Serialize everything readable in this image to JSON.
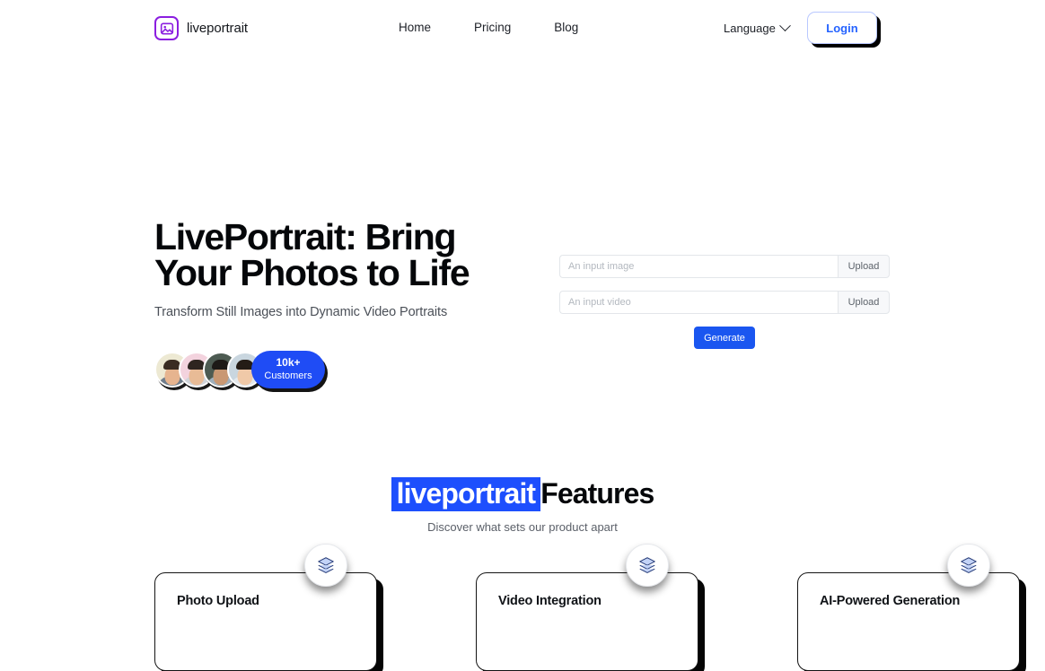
{
  "header": {
    "brand_name": "liveportrait",
    "logo_icon": "image-icon",
    "nav": [
      {
        "label": "Home"
      },
      {
        "label": "Pricing"
      },
      {
        "label": "Blog"
      }
    ],
    "language_label": "Language",
    "language_icon": "chevron-down-icon",
    "login_label": "Login",
    "accent_blue": "#2563ff",
    "logo_purple": "#8b1ee0"
  },
  "hero": {
    "title_line1": "LivePortrait: Bring",
    "title_line2": "Your Photos to Life",
    "subtitle": "Transform Still Images into Dynamic Video Portraits",
    "social_proof": {
      "count": "10k+",
      "label": "Customers",
      "badge_color": "#1f4cf5",
      "avatars": [
        "avatar-1",
        "avatar-2",
        "avatar-3",
        "avatar-4"
      ]
    }
  },
  "form": {
    "image_field": {
      "value": "",
      "placeholder": "An input image",
      "upload_label": "Upload"
    },
    "video_field": {
      "value": "",
      "placeholder": "An input video",
      "upload_label": "Upload"
    },
    "generate_label": "Generate",
    "generate_color": "#1a56f0"
  },
  "features": {
    "title_highlight": "liveportrait",
    "title_rest": "Features",
    "highlight_color": "#1d4ffd",
    "subtitle": "Discover what sets our product apart",
    "cards": [
      {
        "title": "Photo Upload",
        "icon": "layers-icon"
      },
      {
        "title": "Video Integration",
        "icon": "layers-icon"
      },
      {
        "title": "AI-Powered Generation",
        "icon": "layers-icon"
      }
    ]
  }
}
